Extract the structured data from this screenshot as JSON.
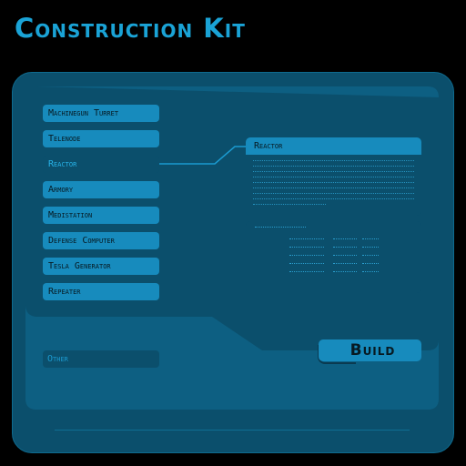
{
  "title": "Construction Kit",
  "items": [
    {
      "label": "Machinegun Turret"
    },
    {
      "label": "Telenode"
    },
    {
      "label": "Reactor"
    },
    {
      "label": "Armory"
    },
    {
      "label": "Medistation"
    },
    {
      "label": "Defense Computer"
    },
    {
      "label": "Tesla Generator"
    },
    {
      "label": "Repeater"
    }
  ],
  "other_label": "Other",
  "detail": {
    "title": "Reactor"
  },
  "build_label": "Build",
  "colors": {
    "accent": "#178bbd",
    "title": "#1aa3d6",
    "panel": "#0b4f6c",
    "frame": "#0b4f6c",
    "inner": "#0d5f82",
    "background": "#000000"
  }
}
